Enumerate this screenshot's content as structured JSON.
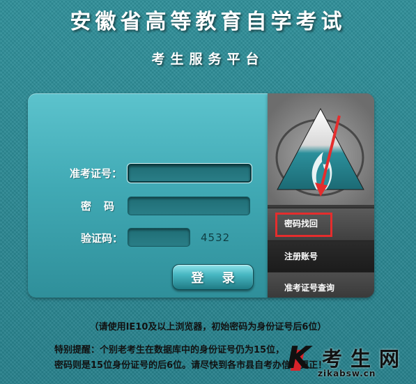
{
  "header": {
    "title": "安徽省高等教育自学考试",
    "subtitle": "考生服务平台"
  },
  "login": {
    "id_label": "准考证号：",
    "password_label": "密码：",
    "captcha_label": "验证码：",
    "id_value": "",
    "password_value": "",
    "captcha_value": "",
    "captcha_code": "4532",
    "login_button": "登 录"
  },
  "side_menu": {
    "logo_icon": "triangle-flame-logo-icon",
    "items": [
      {
        "label": "密码找回"
      },
      {
        "label": "注册账号"
      },
      {
        "label": "准考证号查询"
      }
    ]
  },
  "notices": {
    "line1": "（请使用IE10及以上浏览器，初始密码为身份证号后6位）",
    "line2": "特别提醒：个别老考生在数据库中的身份证号仍为15位，",
    "line3": "密码则是15位身份证号的后6位。请尽快到各市县自考办信息更正！"
  },
  "watermark": {
    "letter": "K",
    "brand": "考生网",
    "url": "zikabsw.cn"
  },
  "colors": {
    "background": "#2b8a94",
    "panel": "#41aab5",
    "annotation": "#e52d2d"
  }
}
